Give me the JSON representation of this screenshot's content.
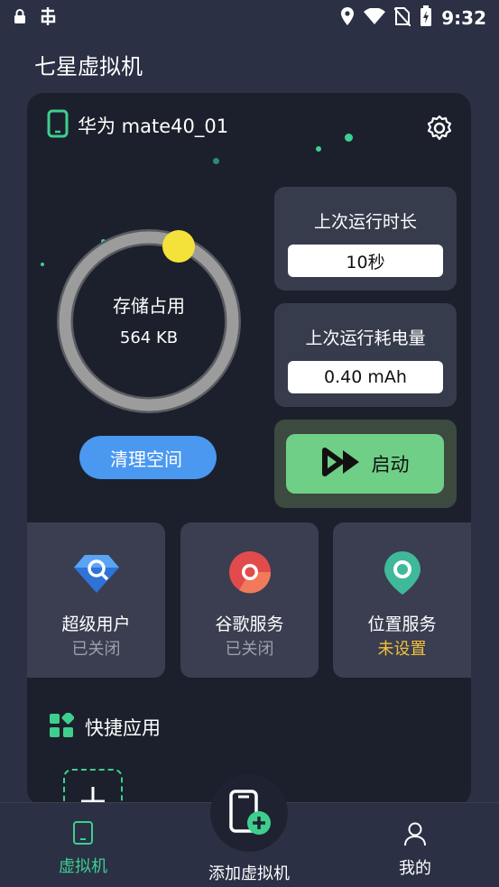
{
  "status_bar": {
    "time": "9:32",
    "left_icons": [
      "lock-icon",
      "app-icon"
    ],
    "right_icons": [
      "location-icon",
      "wifi-icon",
      "no-sim-icon",
      "battery-icon"
    ]
  },
  "app_title": "七星虚拟机",
  "device": {
    "name": "华为 mate40_01",
    "storage_label": "存储占用",
    "storage_value": "564 KB",
    "last_run_duration_title": "上次运行时长",
    "last_run_duration_value": "10秒",
    "last_run_power_title": "上次运行耗电量",
    "last_run_power_value": "0.40 mAh",
    "clean_label": "清理空间",
    "launch_label": "启动"
  },
  "features": [
    {
      "title": "超级用户",
      "status": "已关闭",
      "icon": "user-diamond-icon"
    },
    {
      "title": "谷歌服务",
      "status": "已关闭",
      "icon": "chrome-icon"
    },
    {
      "title": "位置服务",
      "status": "未设置",
      "icon": "location-pin-icon"
    }
  ],
  "quick_apps_title": "快捷应用",
  "nav": {
    "vm_label": "虚拟机",
    "add_label": "添加虚拟机",
    "me_label": "我的",
    "active": "虚拟机"
  },
  "colors": {
    "accent": "#3ecf8e",
    "background": "#2b3045",
    "card": "#1c202c",
    "clean_button": "#4a98f0",
    "launch_button": "#6fcf86",
    "warning": "#f0c03c"
  }
}
